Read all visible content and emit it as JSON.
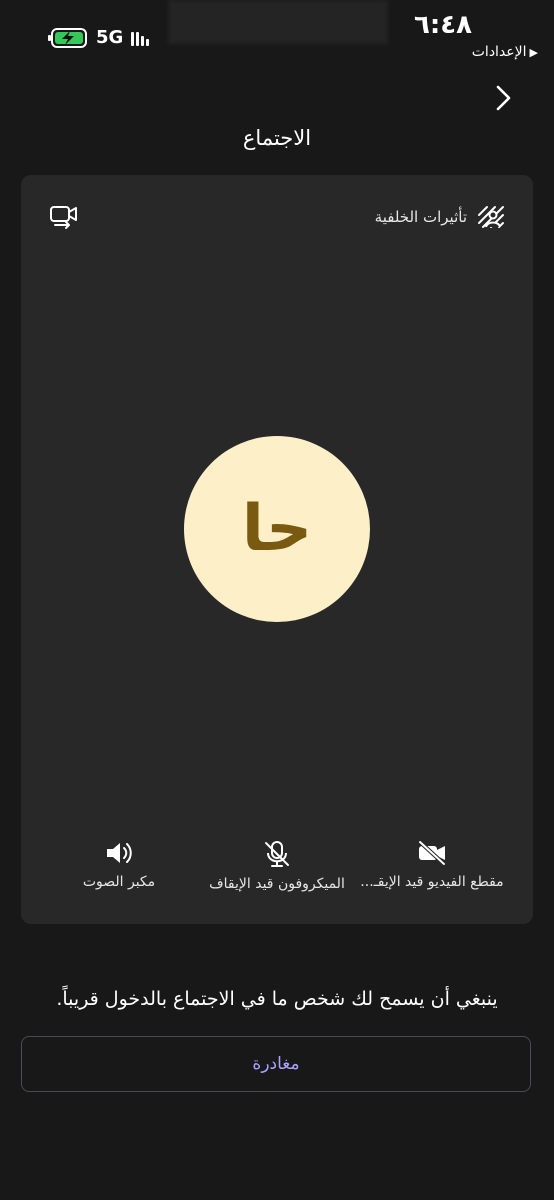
{
  "status_bar": {
    "time": "٦:٤٨",
    "back_to_app": "الإعدادات",
    "network": "5G",
    "signal_bars": 3,
    "battery_charging": true
  },
  "header": {
    "title": "الاجتماع"
  },
  "preview": {
    "background_effects_label": "تأثيرات الخلفية",
    "avatar_initials": "حا",
    "avatar_bg": "#fdefc8",
    "avatar_fg": "#7a5a10"
  },
  "controls": {
    "video_label": "مقطع الفيديو قيد الإيقـ...",
    "mic_label": "الميكروفون قيد الإيقاف",
    "speaker_label": "مكبر الصوت"
  },
  "notice": "ينبغي أن يسمح لك شخص ما في الاجتماع بالدخول قريباً.",
  "leave_button": {
    "label": "مغادرة",
    "color": "#a7a3ff"
  }
}
